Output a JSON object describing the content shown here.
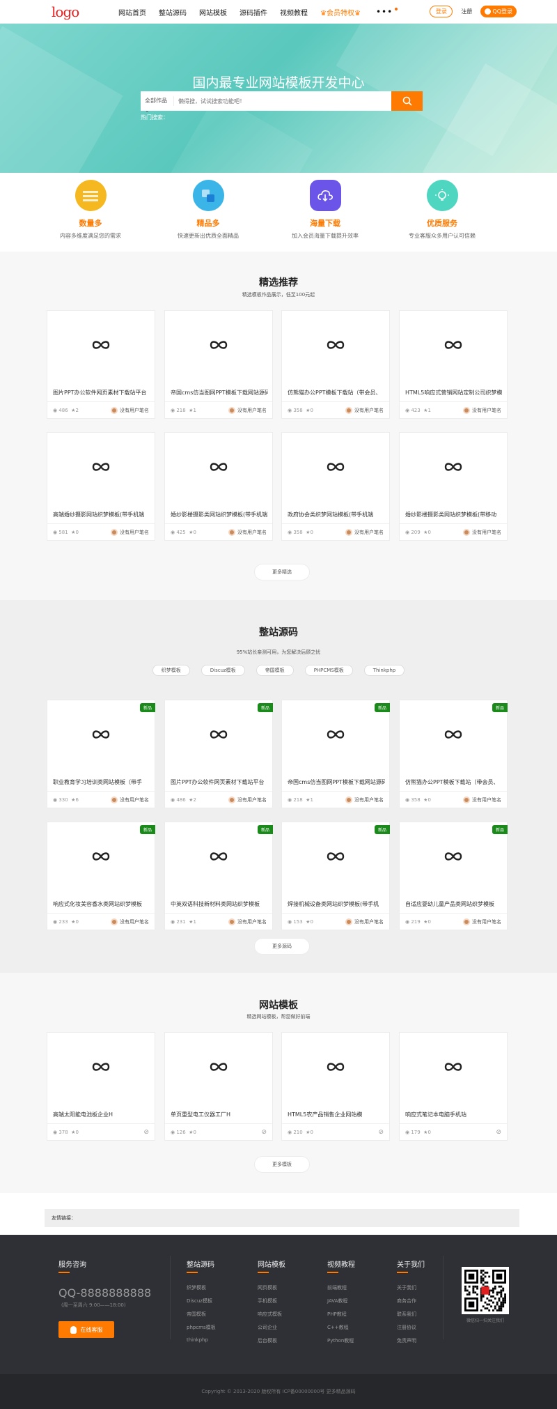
{
  "header": {
    "logo": "logo",
    "nav": [
      "网站首页",
      "整站源码",
      "网站模板",
      "源码插件",
      "视频教程",
      "会员特权"
    ],
    "more": "•••",
    "login": "登录",
    "register": "注册",
    "qq_login": "QQ登录"
  },
  "hero": {
    "title": "国内最专业网站模板开发中心",
    "category": "全部作品",
    "search_placeholder": "懒得搜，试试搜索功能吧！",
    "hotwords": "热门搜索："
  },
  "features": [
    {
      "title": "数量多",
      "desc": "内容多维度满足您的需求",
      "color": "#f5b820"
    },
    {
      "title": "精品多",
      "desc": "快速更新出优质全面精品",
      "color": "#3bb5e8"
    },
    {
      "title": "海量下载",
      "desc": "加入会员海量下载提升效率",
      "color": "#6b55e8"
    },
    {
      "title": "优质服务",
      "desc": "专业客服众多用户认可信赖",
      "color": "#4fd6c0"
    }
  ],
  "featured": {
    "title": "精选推荐",
    "subtitle": "精选模板作品展示，低至100元起",
    "more": "更多精选",
    "items": [
      {
        "title": "图片PPT办公软件网页素材下载站平台",
        "views": "486",
        "likes": "2",
        "author": "没有用户笔名"
      },
      {
        "title": "帝国cms仿当图网PPT模板下载网站源码",
        "views": "218",
        "likes": "1",
        "author": "没有用户笔名"
      },
      {
        "title": "仿熊猫办公PPT模板下载站（带会员、",
        "views": "358",
        "likes": "0",
        "author": "没有用户笔名"
      },
      {
        "title": "HTML5响应式营销网站定制公司织梦模",
        "views": "423",
        "likes": "1",
        "author": "没有用户笔名"
      },
      {
        "title": "高端婚纱摄影网站织梦模板(带手机端",
        "views": "581",
        "likes": "0",
        "author": "没有用户笔名"
      },
      {
        "title": "婚纱影楼摄影类网站织梦模板(带手机端",
        "views": "425",
        "likes": "0",
        "author": "没有用户笔名"
      },
      {
        "title": "政府协会类织梦网站模板(带手机端",
        "views": "358",
        "likes": "0",
        "author": "没有用户笔名"
      },
      {
        "title": "婚纱影楼摄影类网站织梦模板(带移动",
        "views": "209",
        "likes": "0",
        "author": "没有用户笔名"
      }
    ]
  },
  "source": {
    "title": "整站源码",
    "subtitle": "95%站长亲测可用，为您解决后顾之忧",
    "more": "更多源码",
    "tags": [
      "织梦模板",
      "Discuz模板",
      "帝国模板",
      "PHPCMS模板",
      "Thinkphp"
    ],
    "badge": "新品",
    "items": [
      {
        "title": "职业教育学习培训类网站模板（带手",
        "views": "330",
        "likes": "6",
        "author": "没有用户笔名"
      },
      {
        "title": "图片PPT办公软件网页素材下载站平台",
        "views": "486",
        "likes": "2",
        "author": "没有用户笔名"
      },
      {
        "title": "帝国cms仿当图网PPT模板下载网站源码",
        "views": "218",
        "likes": "1",
        "author": "没有用户笔名"
      },
      {
        "title": "仿熊猫办公PPT模板下载站（带会员、",
        "views": "358",
        "likes": "0",
        "author": "没有用户笔名"
      },
      {
        "title": "响应式化妆美容香水类网站织梦模板",
        "views": "233",
        "likes": "0",
        "author": "没有用户笔名"
      },
      {
        "title": "中英双语科技新材料类网站织梦模板",
        "views": "231",
        "likes": "1",
        "author": "没有用户笔名"
      },
      {
        "title": "焊接机械设备类网站织梦模板(带手机",
        "views": "153",
        "likes": "0",
        "author": "没有用户笔名"
      },
      {
        "title": "自适应婴幼儿童产品类网站织梦模板",
        "views": "219",
        "likes": "0",
        "author": "没有用户笔名"
      }
    ]
  },
  "templates": {
    "title": "网站模板",
    "subtitle": "精选网站模板，帮您做好前端",
    "more": "更多模板",
    "items": [
      {
        "title": "高端太阳能电池板企业H",
        "views": "378",
        "likes": "0"
      },
      {
        "title": "单页重型电工仪器工厂H",
        "views": "126",
        "likes": "0"
      },
      {
        "title": "HTML5农产品销售企业网站模",
        "views": "210",
        "likes": "0"
      },
      {
        "title": "响应式笔记本电脑手机站",
        "views": "179",
        "likes": "0"
      }
    ]
  },
  "links": {
    "label": "友情链接："
  },
  "footer": {
    "service_title": "服务咨询",
    "qq": "QQ-8888888888",
    "hours": "(周一至周六 9:00——18:00)",
    "online": "在线客服",
    "cols": [
      {
        "title": "整站源码",
        "items": [
          "织梦模板",
          "Discuz模板",
          "帝国模板",
          "phpcms模板",
          "thinkphp"
        ]
      },
      {
        "title": "网站模板",
        "items": [
          "网页模板",
          "手机模板",
          "响应式模板",
          "公司企业",
          "后台模板"
        ]
      },
      {
        "title": "视频教程",
        "items": [
          "前端教程",
          "JAVA教程",
          "PHP教程",
          "C++教程",
          "Python教程"
        ]
      },
      {
        "title": "关于我们",
        "items": [
          "关于我们",
          "商务合作",
          "联系我们",
          "注册协议",
          "免责声明"
        ]
      }
    ],
    "qr_text": "微信扫一扫关注我们",
    "copyright": "Copyright © 2013-2020 版权所有 ICP备00000000号 更多精品源码"
  }
}
